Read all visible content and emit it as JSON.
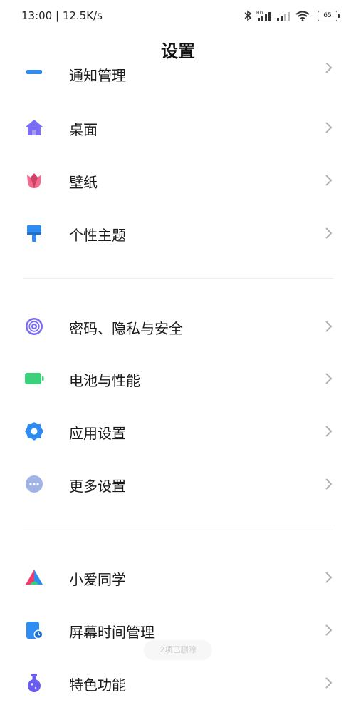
{
  "status_bar": {
    "time_speed": "13:00 | 12.5K/s",
    "icons": [
      "bluetooth-icon",
      "hd-signal-icon",
      "signal-icon",
      "wifi-icon",
      "battery-icon"
    ],
    "battery_level": "65"
  },
  "header": {
    "title": "设置"
  },
  "colors": {
    "home": "#7a6cf5",
    "wallpaper": "#f06a8a",
    "theme": "#2f8df2",
    "privacy": "#7a6cf5",
    "battery": "#3bd17a",
    "apps": "#2f8df2",
    "more": "#9fb3e6",
    "xiaoai": "#f23b6b",
    "screen_time": "#2f8df2",
    "features": "#6a5cf0"
  },
  "sections": [
    {
      "items": [
        {
          "label": "通知管理",
          "icon": "notification-icon"
        },
        {
          "label": "桌面",
          "icon": "home-icon"
        },
        {
          "label": "壁纸",
          "icon": "tulip-icon"
        },
        {
          "label": "个性主题",
          "icon": "paintbrush-icon"
        }
      ]
    },
    {
      "items": [
        {
          "label": "密码、隐私与安全",
          "icon": "fingerprint-icon"
        },
        {
          "label": "电池与性能",
          "icon": "battery-icon"
        },
        {
          "label": "应用设置",
          "icon": "gear-icon"
        },
        {
          "label": "更多设置",
          "icon": "more-dots-icon"
        }
      ]
    },
    {
      "items": [
        {
          "label": "小爱同学",
          "icon": "xiaoai-icon"
        },
        {
          "label": "屏幕时间管理",
          "icon": "screen-time-icon"
        },
        {
          "label": "特色功能",
          "icon": "flask-icon"
        }
      ]
    }
  ],
  "toast": {
    "text": "2项已删除"
  }
}
